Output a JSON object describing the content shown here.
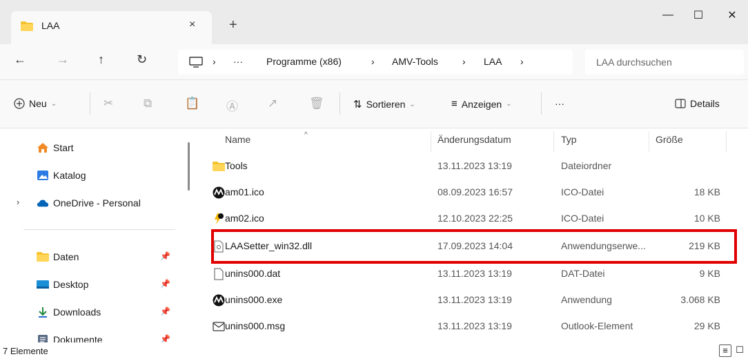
{
  "tab": {
    "title": "LAA",
    "close_symbol": "×",
    "new_symbol": "+"
  },
  "window": {
    "minimize": "—",
    "maximize": "☐",
    "close": "✕"
  },
  "nav": {
    "back": "←",
    "forward": "→",
    "up": "↑",
    "refresh": "↻"
  },
  "address": {
    "ellipsis": "···",
    "separator": "›",
    "segments": [
      "Programme (x86)",
      "AMV-Tools",
      "LAA"
    ]
  },
  "search": {
    "placeholder": "LAA durchsuchen"
  },
  "toolbar": {
    "new_label": "Neu",
    "sort_label": "Sortieren",
    "view_label": "Anzeigen",
    "more_label": "···",
    "details_label": "Details"
  },
  "sidebar": {
    "items": [
      {
        "label": "Start"
      },
      {
        "label": "Katalog"
      },
      {
        "label": "OneDrive - Personal"
      },
      {
        "label": "Daten"
      },
      {
        "label": "Desktop"
      },
      {
        "label": "Downloads"
      },
      {
        "label": "Dokumente"
      }
    ]
  },
  "columns": {
    "name": "Name",
    "date": "Änderungsdatum",
    "type": "Typ",
    "size": "Größe"
  },
  "files": [
    {
      "name": "Tools",
      "date": "13.11.2023 13:19",
      "type": "Dateiordner",
      "size": "",
      "icon": "folder-icon"
    },
    {
      "name": "am01.ico",
      "date": "08.09.2023 16:57",
      "type": "ICO-Datei",
      "size": "18 KB",
      "icon": "amv-logo-icon"
    },
    {
      "name": "am02.ico",
      "date": "12.10.2023 22:25",
      "type": "ICO-Datei",
      "size": "10 KB",
      "icon": "amv-bolt-icon"
    },
    {
      "name": "LAASetter_win32.dll",
      "date": "17.09.2023 14:04",
      "type": "Anwendungserwe...",
      "size": "219 KB",
      "icon": "dll-file-icon"
    },
    {
      "name": "unins000.dat",
      "date": "13.11.2023 13:19",
      "type": "DAT-Datei",
      "size": "9 KB",
      "icon": "blank-file-icon"
    },
    {
      "name": "unins000.exe",
      "date": "13.11.2023 13:19",
      "type": "Anwendung",
      "size": "3.068 KB",
      "icon": "amv-logo-icon"
    },
    {
      "name": "unins000.msg",
      "date": "13.11.2023 13:19",
      "type": "Outlook-Element",
      "size": "29 KB",
      "icon": "mail-icon"
    }
  ],
  "status": {
    "item_count": "7 Elemente"
  },
  "colors": {
    "highlight": "#e00000",
    "folder": "#f4c430",
    "onedrive": "#0364b8"
  }
}
